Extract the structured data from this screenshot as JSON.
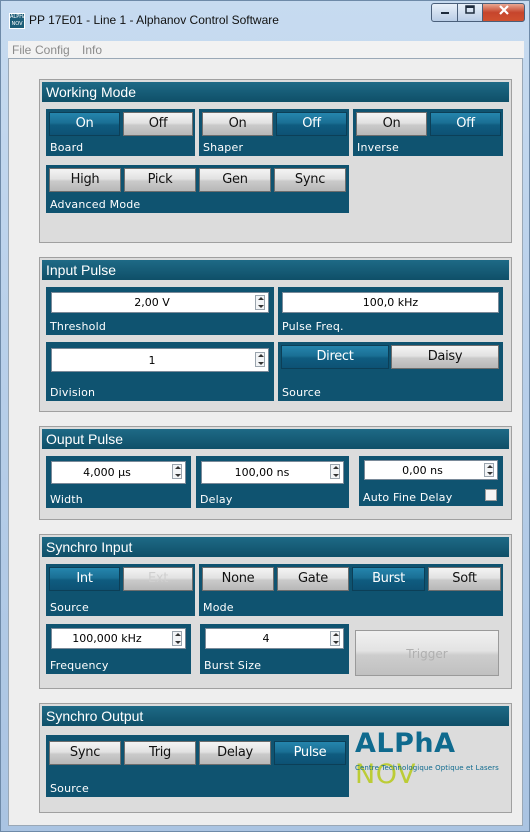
{
  "window": {
    "icon_text": "ALPHA NOV",
    "title": "PP 17E01 - Line 1 - Alphanov Control Software"
  },
  "menu": [
    "File",
    "Config",
    "Info"
  ],
  "working_mode": {
    "title": "Working Mode",
    "board": {
      "label": "Board",
      "on": "On",
      "off": "Off",
      "selected": "On"
    },
    "shaper": {
      "label": "Shaper",
      "on": "On",
      "off": "Off",
      "selected": "Off"
    },
    "inverse": {
      "label": "Inverse",
      "on": "On",
      "off": "Off",
      "selected": "Off"
    },
    "advanced": {
      "label": "Advanced Mode",
      "buttons": [
        "High",
        "Pick",
        "Gen",
        "Sync"
      ]
    }
  },
  "input_pulse": {
    "title": "Input Pulse",
    "threshold": {
      "label": "Threshold",
      "value": "2,00 V"
    },
    "pulse_freq": {
      "label": "Pulse Freq.",
      "value": "100,0 kHz"
    },
    "division": {
      "label": "Division",
      "value": "1"
    },
    "source": {
      "label": "Source",
      "options": [
        "Direct",
        "Daisy"
      ],
      "selected": "Direct"
    }
  },
  "output_pulse": {
    "title": "Ouput Pulse",
    "width": {
      "label": "Width",
      "value": "4,000 µs"
    },
    "delay": {
      "label": "Delay",
      "value": "100,00 ns"
    },
    "fine_delay": {
      "label": "Auto Fine Delay",
      "value": "0,00 ns",
      "checked": false
    }
  },
  "synchro_input": {
    "title": "Synchro Input",
    "source": {
      "label": "Source",
      "options": [
        "Int",
        "Ext"
      ],
      "selected": "Int"
    },
    "mode": {
      "label": "Mode",
      "options": [
        "None",
        "Gate",
        "Burst",
        "Soft"
      ],
      "selected": "Burst"
    },
    "frequency": {
      "label": "Frequency",
      "value": "100,000 kHz"
    },
    "burst_size": {
      "label": "Burst Size",
      "value": "4"
    },
    "trigger": "Trigger"
  },
  "synchro_output": {
    "title": "Synchro Output",
    "source": {
      "label": "Source",
      "options": [
        "Sync",
        "Trig",
        "Delay",
        "Pulse"
      ],
      "selected": "Pulse"
    }
  },
  "logo": {
    "alpha": "ALPhA",
    "nov": "NOV",
    "tagline": "Centre Technologique Optique et Lasers"
  },
  "colors": {
    "header": "#0f4f68",
    "active_button": "#1a6f94",
    "logo_blue": "#0f6a8e",
    "logo_green": "#bccc36"
  }
}
